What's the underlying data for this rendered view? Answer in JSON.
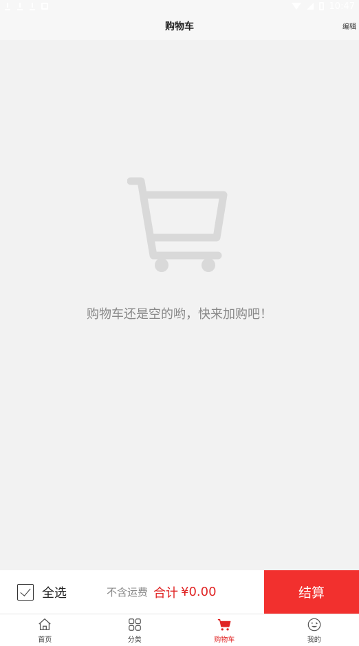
{
  "status_bar": {
    "time": "10:47"
  },
  "nav": {
    "title": "购物车",
    "edit_label": "编辑"
  },
  "empty_state": {
    "message": "购物车还是空的哟，快来加购吧！",
    "icon": "shopping-cart-icon"
  },
  "checkout": {
    "select_all_label": "全选",
    "shipping_note": "不含运费",
    "total_label": "合计",
    "total_value": "¥0.00",
    "checkout_label": "结算"
  },
  "tabs": [
    {
      "label": "首页",
      "icon": "home-icon",
      "active": false
    },
    {
      "label": "分类",
      "icon": "category-grid-icon",
      "active": false
    },
    {
      "label": "购物车",
      "icon": "cart-icon",
      "active": true
    },
    {
      "label": "我的",
      "icon": "smiley-icon",
      "active": false
    }
  ],
  "colors": {
    "accent": "#f2302e",
    "price": "#e02424",
    "background": "#f2f2f2"
  }
}
